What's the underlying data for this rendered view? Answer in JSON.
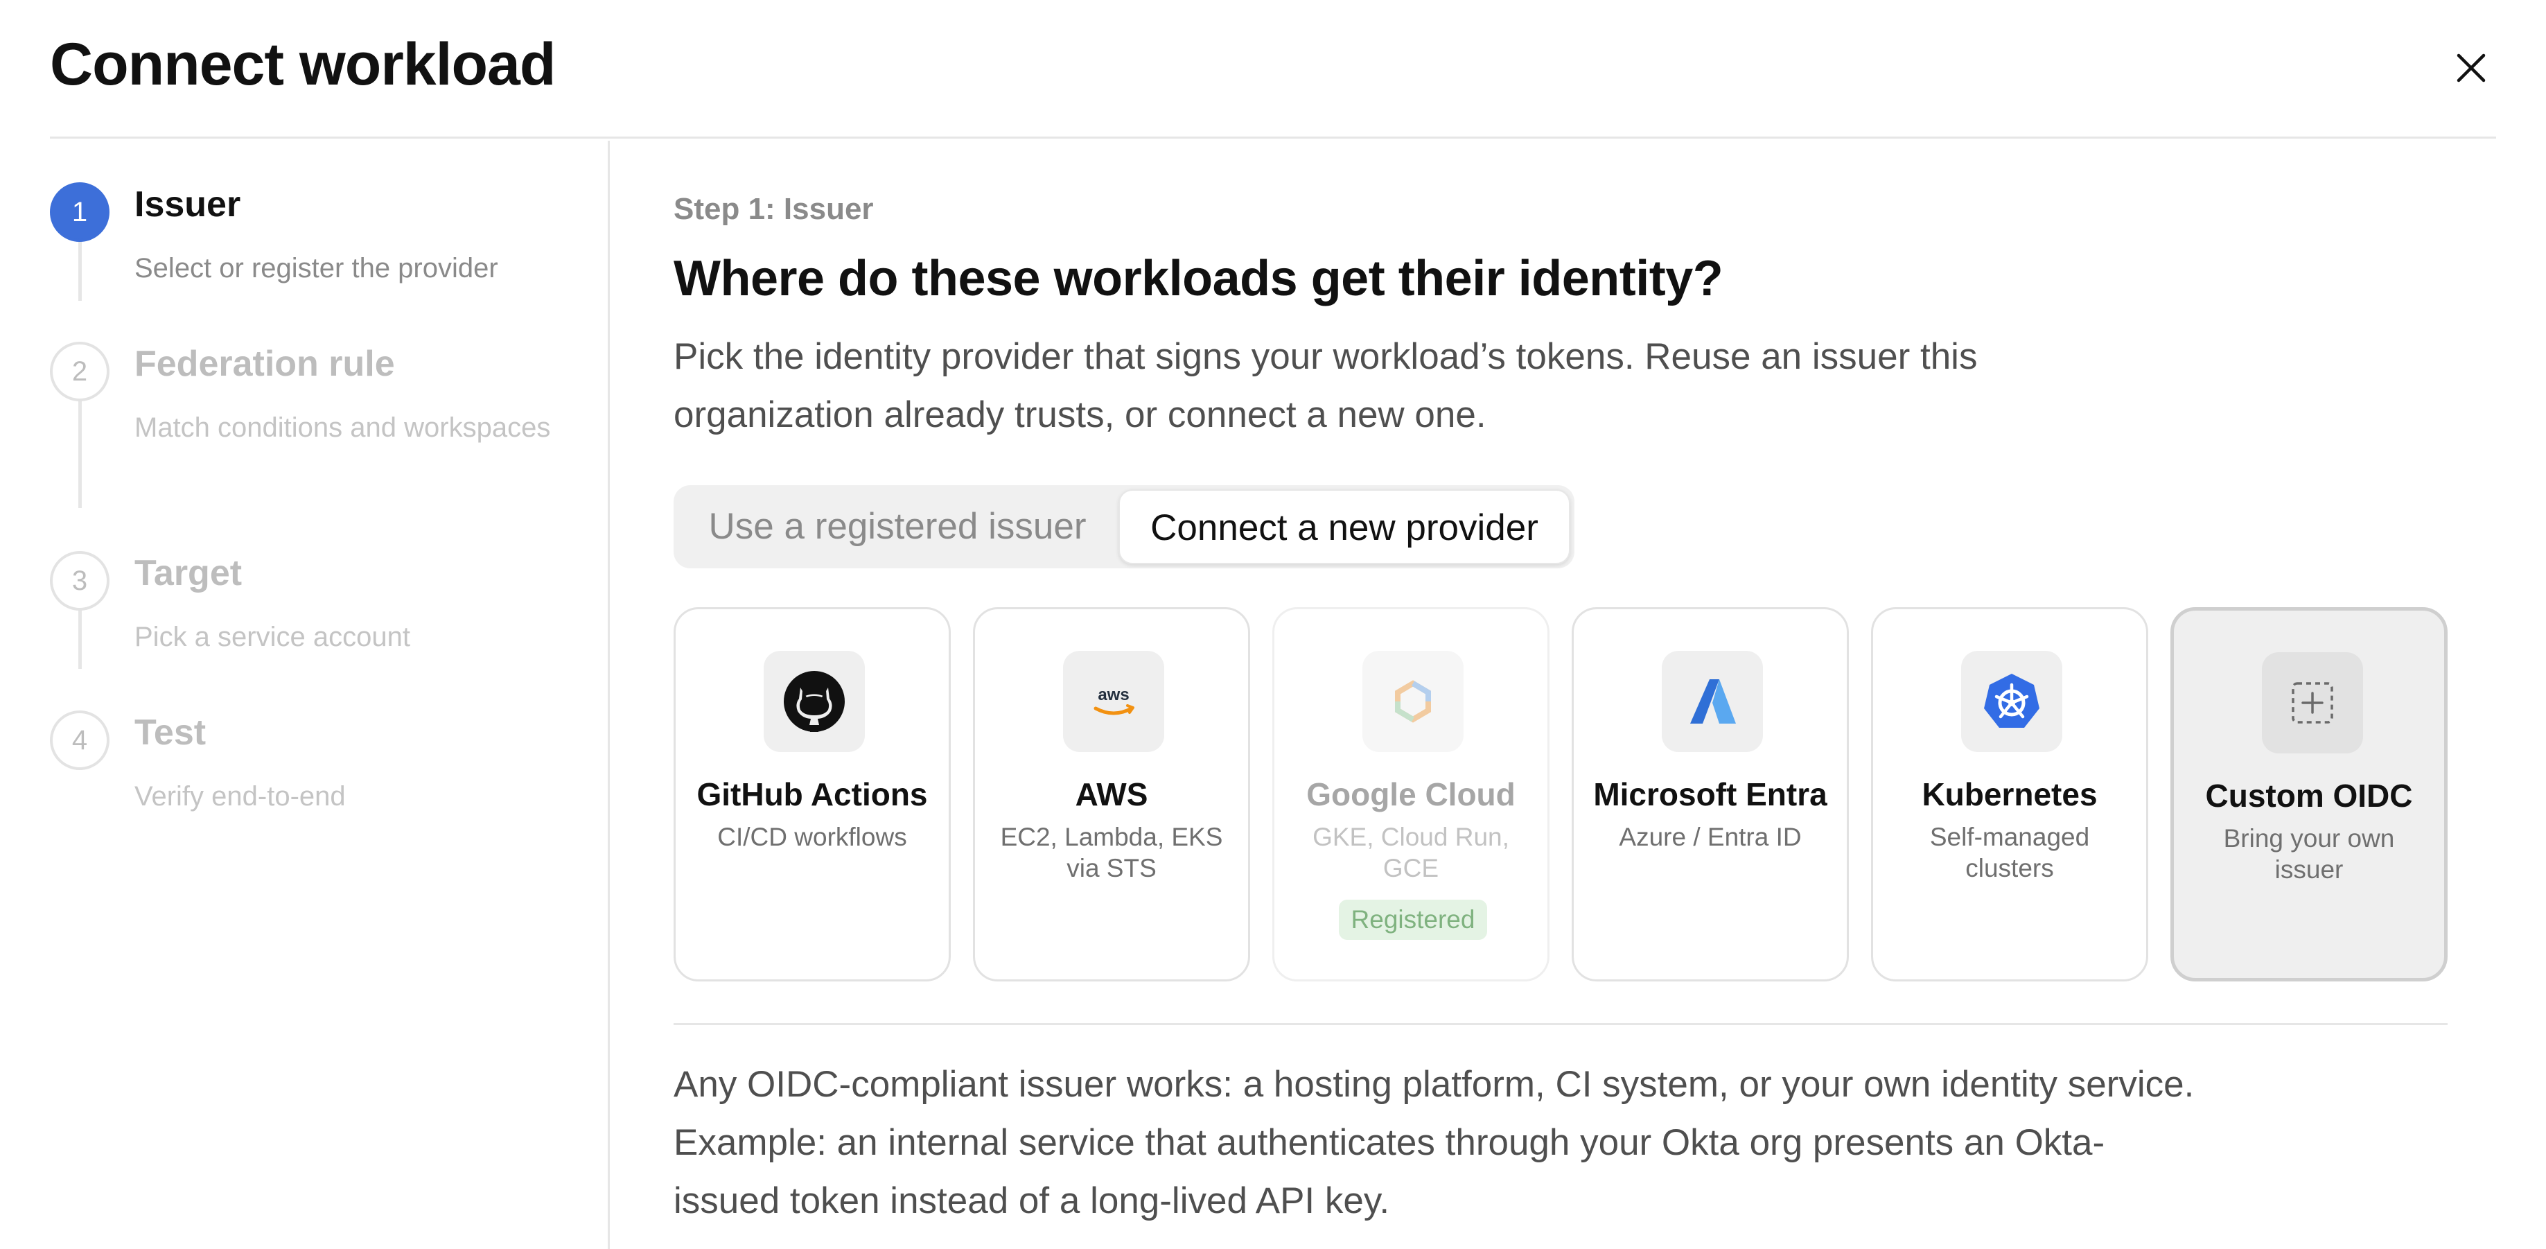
{
  "modal": {
    "title": "Connect workload"
  },
  "steps": [
    {
      "number": "1",
      "name": "Issuer",
      "description": "Select or register the provider",
      "state": "active"
    },
    {
      "number": "2",
      "name": "Federation rule",
      "description": "Match conditions and workspaces",
      "state": "upcoming"
    },
    {
      "number": "3",
      "name": "Target",
      "description": "Pick a service account",
      "state": "upcoming"
    },
    {
      "number": "4",
      "name": "Test",
      "description": "Verify end-to-end",
      "state": "upcoming"
    }
  ],
  "main": {
    "eyebrow": "Step 1: Issuer",
    "question": "Where do these workloads get their identity?",
    "intro": "Pick the identity provider that signs your workload’s tokens. Reuse an issuer this organization already trusts, or connect a new one.",
    "toggle": {
      "options": [
        "Use a registered issuer",
        "Connect a new provider"
      ],
      "selected": "Connect a new provider"
    },
    "providers": [
      {
        "title": "GitHub Actions",
        "subtitle": "CI/CD workflows",
        "icon": "github-icon"
      },
      {
        "title": "AWS",
        "subtitle": "EC2, Lambda, EKS via STS",
        "icon": "aws-icon",
        "icon_text": "aws"
      },
      {
        "title": "Google Cloud",
        "subtitle": "GKE, Cloud Run, GCE",
        "icon": "google-cloud-icon",
        "badge": "Registered",
        "state": "disabled"
      },
      {
        "title": "Microsoft Entra",
        "subtitle": "Azure / Entra ID",
        "icon": "microsoft-entra-icon"
      },
      {
        "title": "Kubernetes",
        "subtitle": "Self-managed clusters",
        "icon": "kubernetes-icon"
      },
      {
        "title": "Custom OIDC",
        "subtitle": "Bring your own issuer",
        "icon": "custom-add-icon",
        "state": "selected"
      }
    ],
    "explanation": "Any OIDC-compliant issuer works: a hosting platform, CI system, or your own identity service. Example: an internal service that authenticates through your Okta org presents an Okta-issued token instead of a long-lived API key."
  },
  "colors": {
    "accent": "#3d6fd9",
    "badge_bg": "#e4f3e4",
    "badge_text": "#7fb27f",
    "selected_card_bg": "#efefef"
  },
  "icons": {
    "close": "close-icon"
  }
}
